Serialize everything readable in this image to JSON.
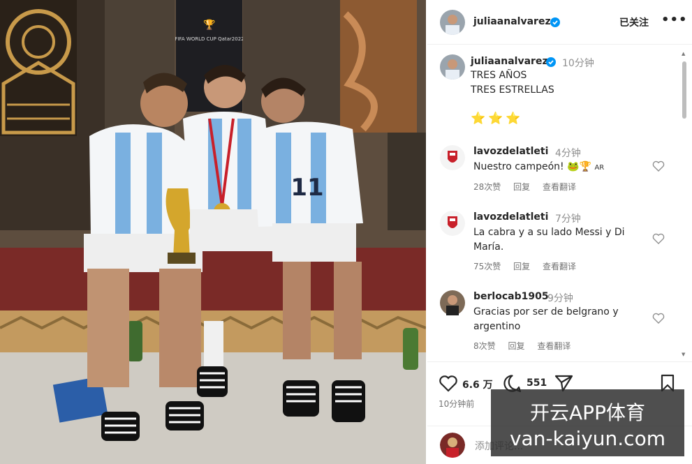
{
  "post": {
    "username": "juliaanalvarez",
    "follow_label": "已关注",
    "more_label": "•••",
    "caption_username": "juliaanalvarez",
    "caption_time": "10分钟",
    "caption_lines": [
      "TRES AÑOS",
      "TRES ESTRELLAS"
    ],
    "caption_stars": "⭐⭐⭐",
    "photo_banner": "FIFA WORLD CUP Qatar2022"
  },
  "comments": [
    {
      "username": "lavozdelatleti",
      "time": "4分钟",
      "text": "Nuestro campeón! 🐸🏆",
      "badge": "AR",
      "likes": "28次赞",
      "reply": "回复",
      "translate": "查看翻译"
    },
    {
      "username": "lavozdelatleti",
      "time": "7分钟",
      "text": "La cabra y a su lado Messi y Di María.",
      "likes": "75次赞",
      "reply": "回复",
      "translate": "查看翻译"
    },
    {
      "username": "berlocab1905",
      "time": "9分钟",
      "text": "Gracias por ser de belgrano y argentino",
      "likes": "8次赞",
      "reply": "回复",
      "translate": "查看翻译"
    }
  ],
  "actions": {
    "likes_count": "6.6 万",
    "comments_count": "551",
    "post_time": "10分钟前"
  },
  "add_comment": {
    "placeholder": "添加评论..."
  },
  "watermark": {
    "line1": "开云APP体育",
    "line2": "van-kaiyun.com"
  },
  "colors": {
    "verified": "#0095f6",
    "text": "#262626",
    "muted": "#8e8e8e",
    "star": "#f0b429"
  },
  "icons": [
    "verified-badge-icon",
    "heart-icon",
    "comment-icon",
    "share-icon",
    "bookmark-icon",
    "more-icon"
  ]
}
